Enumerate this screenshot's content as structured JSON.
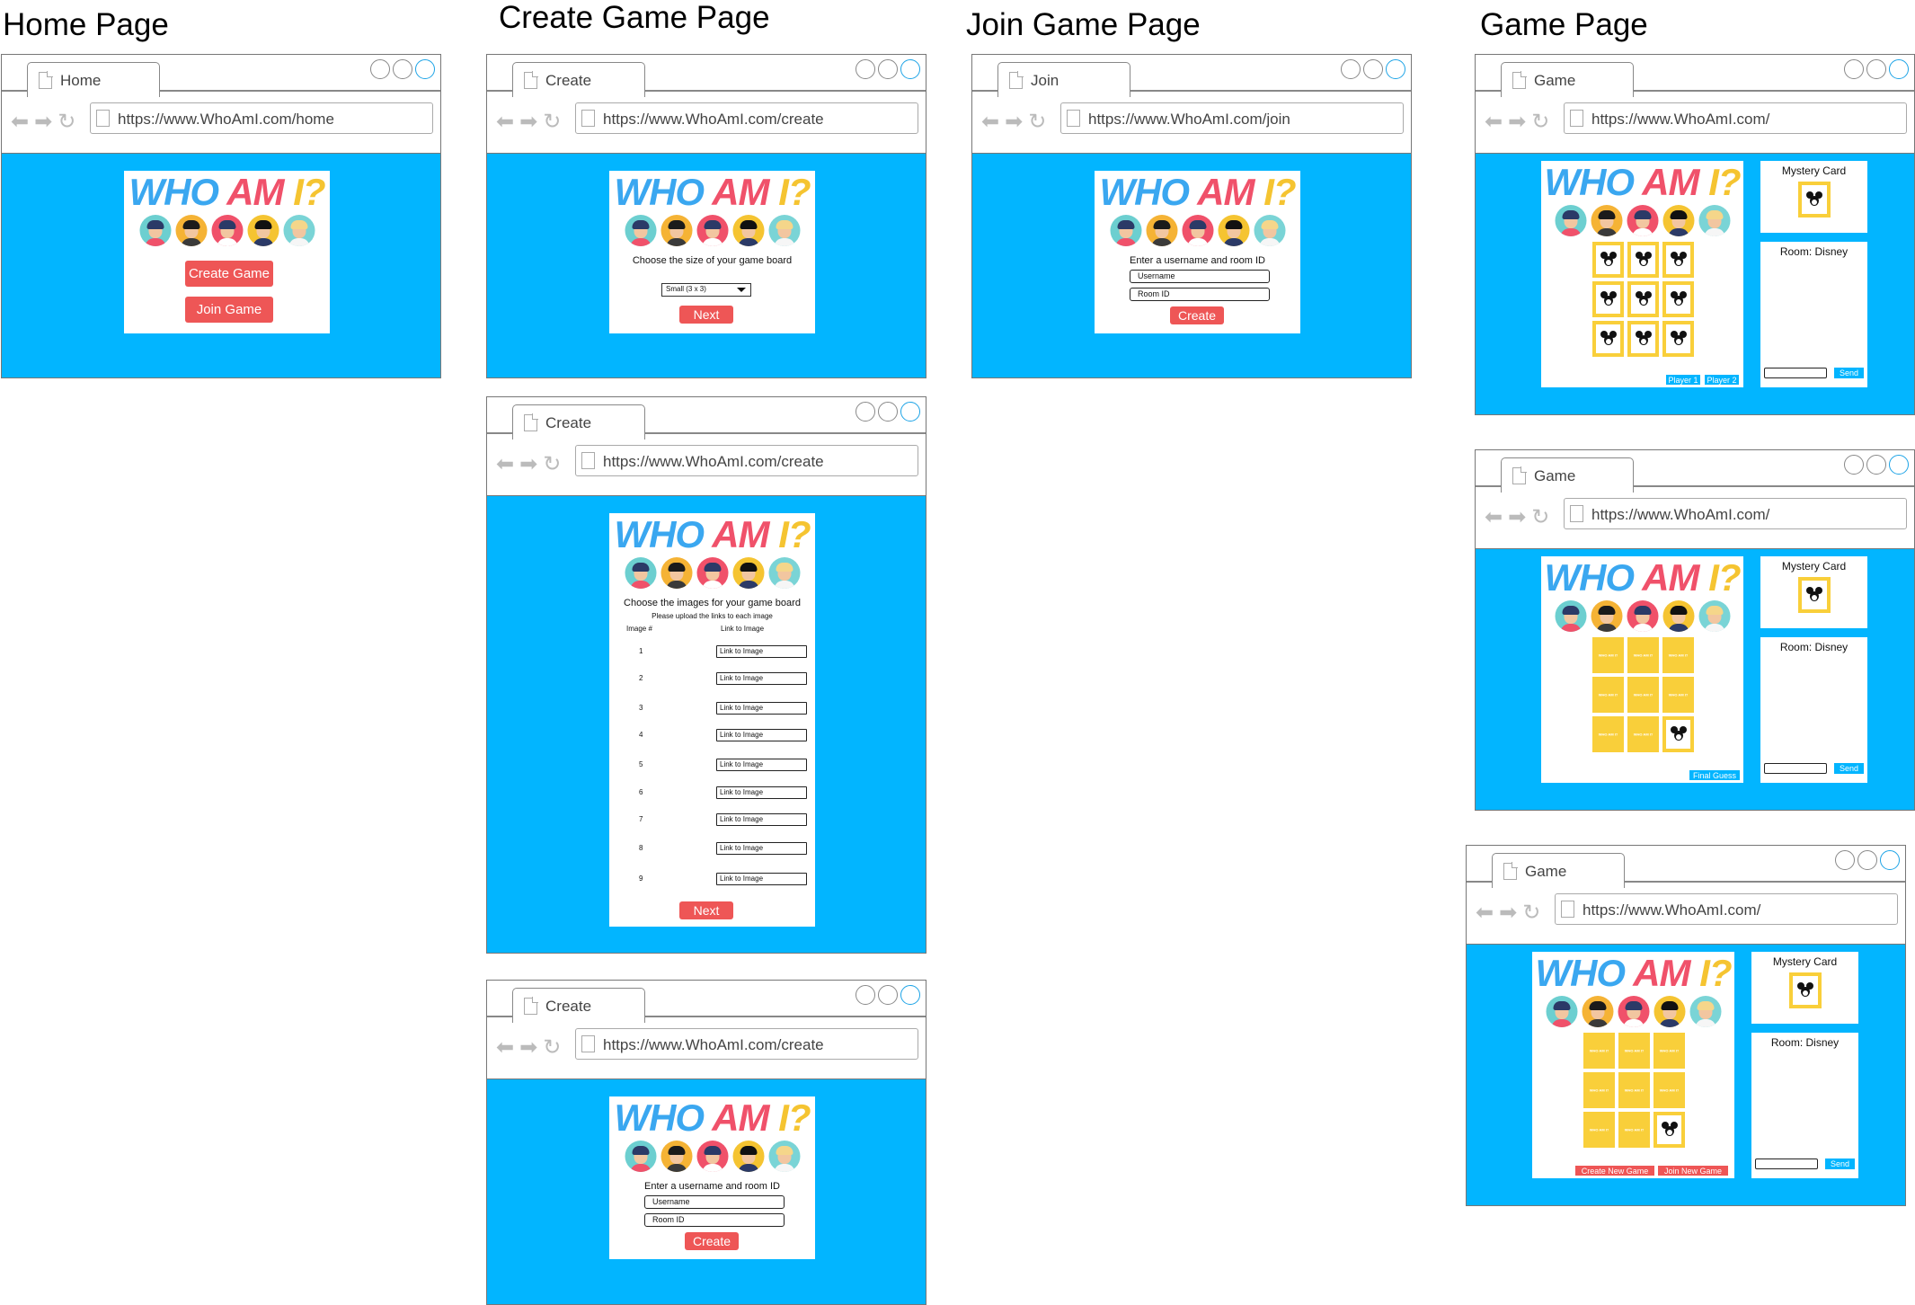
{
  "sections": {
    "home": "Home Page",
    "create": "Create Game Page",
    "join": "Join Game Page",
    "game": "Game Page"
  },
  "tabs": {
    "home": "Home",
    "create": "Create",
    "join": "Join",
    "game": "Game"
  },
  "urls": {
    "home": "https://www.WhoAmI.com/home",
    "create": "https://www.WhoAmI.com/create",
    "join": "https://www.WhoAmI.com/join",
    "game": "https://www.WhoAmI.com/"
  },
  "logo": {
    "who": "WHO",
    "am": "AM",
    "i": "I?"
  },
  "home": {
    "create_game": "Create Game",
    "join_game": "Join Game"
  },
  "create1": {
    "prompt": "Choose the size of your game board",
    "size_option": "Small (3 x 3)",
    "next": "Next"
  },
  "create2": {
    "prompt": "Choose the images for your game board",
    "subprompt": "Please upload the links to each image",
    "col_num": "Image #",
    "col_link": "Link to Image",
    "rows": [
      "1",
      "2",
      "3",
      "4",
      "5",
      "6",
      "7",
      "8",
      "9"
    ],
    "placeholder": "Link to Image",
    "next": "Next"
  },
  "create3": {
    "prompt": "Enter a username and room ID",
    "username": "Username",
    "room_id": "Room ID",
    "create": "Create"
  },
  "join": {
    "prompt": "Enter a username and room ID",
    "username": "Username",
    "room_id": "Room ID",
    "create": "Create"
  },
  "game": {
    "mystery_card": "Mystery Card",
    "room": "Room: Disney",
    "send": "Send",
    "player1": "Player 1",
    "player2": "Player 2",
    "final_guess": "Final Guess",
    "create_new_game": "Create New Game",
    "join_new_game": "Join New Game",
    "card_back": "WHO AM I?"
  },
  "colors": {
    "background": "#02b5ff",
    "red_button": "#ee5656",
    "card_yellow": "#f9cf3a",
    "logo_blue": "#3aa7f0",
    "logo_red": "#f0516a",
    "logo_yellow": "#f5c431"
  }
}
